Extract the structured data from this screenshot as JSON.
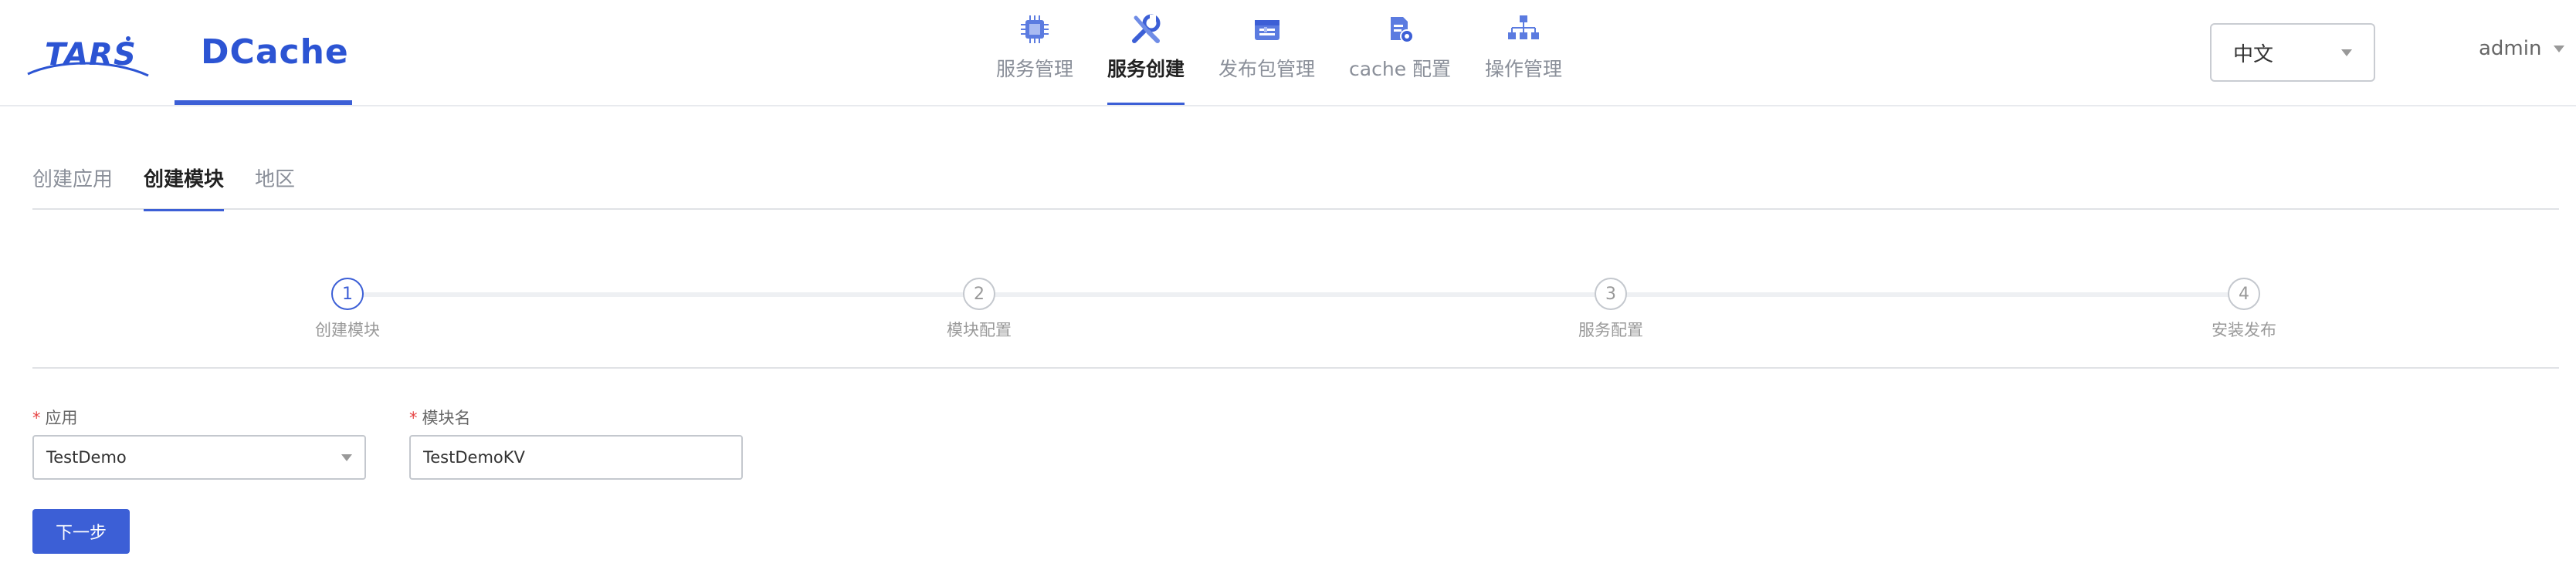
{
  "header": {
    "logo_tars": "TARS",
    "logo_dcache": "DCache",
    "nav": [
      {
        "label": "服务管理",
        "icon": "chip-icon",
        "active": false
      },
      {
        "label": "服务创建",
        "icon": "wrench-icon",
        "active": true
      },
      {
        "label": "发布包管理",
        "icon": "package-icon",
        "active": false
      },
      {
        "label": "cache 配置",
        "icon": "config-file-icon",
        "active": false
      },
      {
        "label": "操作管理",
        "icon": "network-tree-icon",
        "active": false
      }
    ],
    "language": "中文",
    "user": "admin"
  },
  "subtabs": [
    {
      "label": "创建应用",
      "active": false
    },
    {
      "label": "创建模块",
      "active": true
    },
    {
      "label": "地区",
      "active": false
    }
  ],
  "steps": [
    {
      "number": "1",
      "label": "创建模块",
      "active": true
    },
    {
      "number": "2",
      "label": "模块配置",
      "active": false
    },
    {
      "number": "3",
      "label": "服务配置",
      "active": false
    },
    {
      "number": "4",
      "label": "安装发布",
      "active": false
    }
  ],
  "form": {
    "app_required": "*",
    "app_label": "应用",
    "app_value": "TestDemo",
    "module_required": "*",
    "module_label": "模块名",
    "module_value": "TestDemoKV",
    "next_label": "下一步"
  },
  "colors": {
    "accent": "#3c5fd6",
    "logo": "#2c54d3",
    "required": "#e64545"
  }
}
